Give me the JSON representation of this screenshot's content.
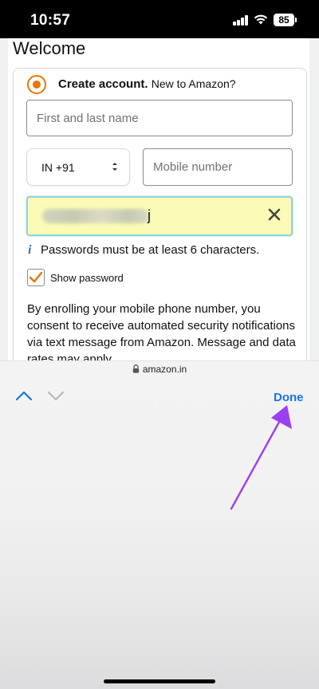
{
  "status_bar": {
    "time": "10:57",
    "battery": "85",
    "icons": [
      "signal-icon",
      "wifi-icon",
      "battery-icon"
    ]
  },
  "page": {
    "heading": "Welcome",
    "create_account": {
      "bold_label": "Create account.",
      "sub_label": "New to Amazon?",
      "selected": true
    },
    "name_field": {
      "placeholder": "First and last name",
      "value": ""
    },
    "country_code": {
      "value": "IN +91"
    },
    "mobile_field": {
      "placeholder": "Mobile number",
      "value": ""
    },
    "password_field": {
      "visible_char": "j"
    },
    "password_hint": {
      "icon": "i",
      "text": "Passwords must be at least 6 characters."
    },
    "show_password": {
      "label": "Show password",
      "checked": true
    },
    "consent_text": "By enrolling your mobile phone number, you consent to receive automated security notifications via text message from Amazon. Message and data rates may apply."
  },
  "url_bar": {
    "domain": "amazon.in"
  },
  "keyboard_toolbar": {
    "done_label": "Done"
  },
  "colors": {
    "radio_accent": "#e77600",
    "done_blue": "#1a73e8",
    "autofill_yellow": "#fbfbb6",
    "annotation_purple": "#9b3ff0"
  }
}
